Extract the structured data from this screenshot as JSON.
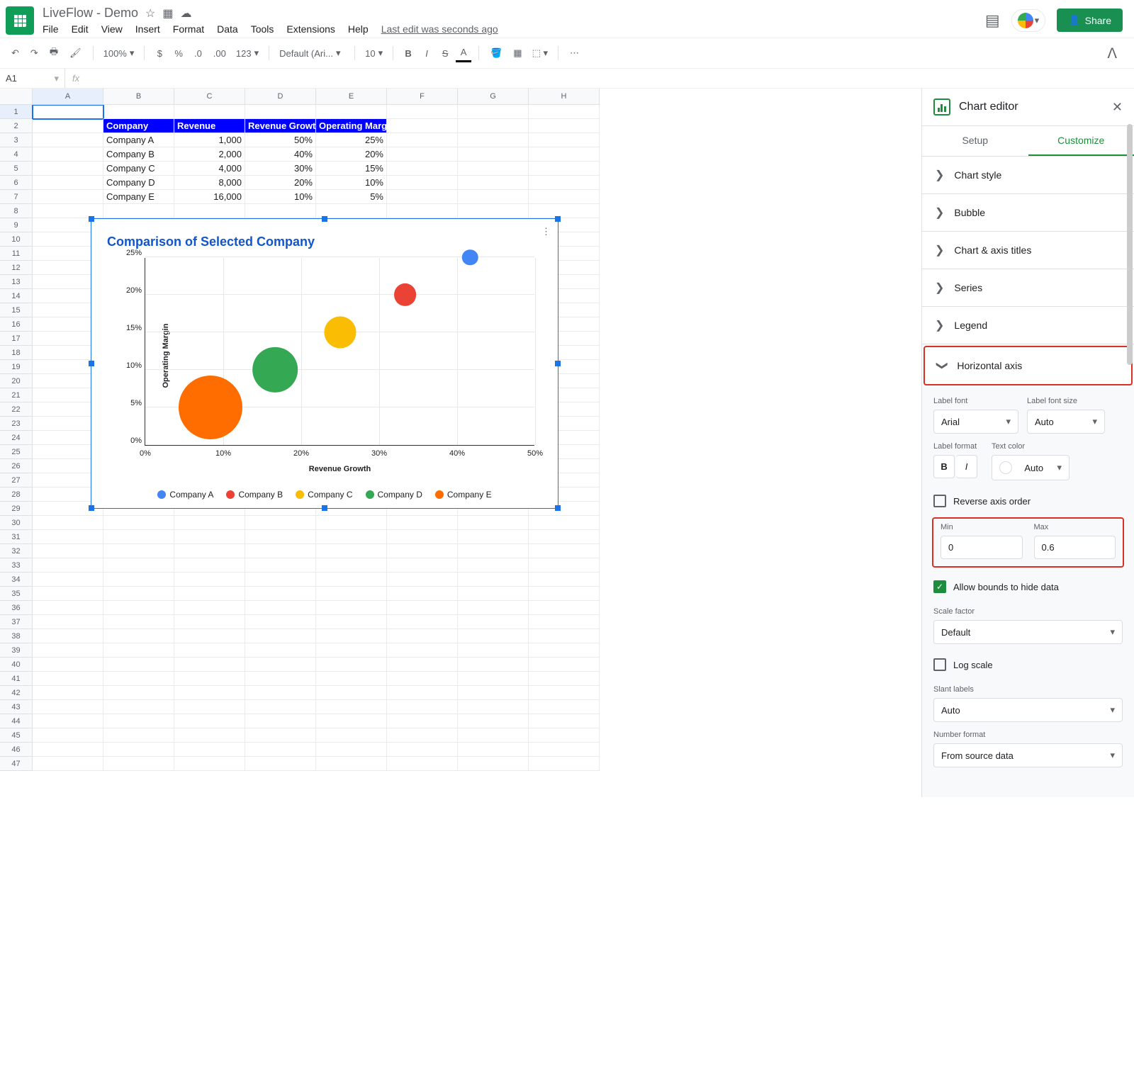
{
  "doc": {
    "title": "LiveFlow - Demo"
  },
  "menu": {
    "file": "File",
    "edit": "Edit",
    "view": "View",
    "insert": "Insert",
    "format": "Format",
    "data": "Data",
    "tools": "Tools",
    "extensions": "Extensions",
    "help": "Help",
    "last_edit": "Last edit was seconds ago"
  },
  "share": {
    "label": "Share"
  },
  "toolbar": {
    "zoom": "100%",
    "font": "Default (Ari...",
    "size": "10",
    "number_fmt": "123"
  },
  "name_box": "A1",
  "columns": [
    "A",
    "B",
    "C",
    "D",
    "E",
    "F",
    "G",
    "H"
  ],
  "table": {
    "headers": [
      "Company",
      "Revenue",
      "Revenue Growth",
      "Operating Margin"
    ],
    "rows": [
      [
        "Company A",
        "1,000",
        "50%",
        "25%"
      ],
      [
        "Company B",
        "2,000",
        "40%",
        "20%"
      ],
      [
        "Company C",
        "4,000",
        "30%",
        "15%"
      ],
      [
        "Company D",
        "8,000",
        "20%",
        "10%"
      ],
      [
        "Company E",
        "16,000",
        "10%",
        "5%"
      ]
    ]
  },
  "chart_data": {
    "type": "bubble",
    "title": "Comparison of Selected Company",
    "xlabel": "Revenue Growth",
    "ylabel": "Operating Margin",
    "xticks": [
      "0%",
      "10%",
      "20%",
      "30%",
      "40%",
      "50%"
    ],
    "yticks": [
      "0%",
      "5%",
      "10%",
      "15%",
      "20%",
      "25%"
    ],
    "xlim": [
      0,
      0.6
    ],
    "ylim": [
      0,
      0.25
    ],
    "series": [
      {
        "name": "Company A",
        "x": 0.5,
        "y": 0.25,
        "size": 1000,
        "color": "#4285f4"
      },
      {
        "name": "Company B",
        "x": 0.4,
        "y": 0.2,
        "size": 2000,
        "color": "#ea4335"
      },
      {
        "name": "Company C",
        "x": 0.3,
        "y": 0.15,
        "size": 4000,
        "color": "#fbbc04"
      },
      {
        "name": "Company D",
        "x": 0.2,
        "y": 0.1,
        "size": 8000,
        "color": "#34a853"
      },
      {
        "name": "Company E",
        "x": 0.1,
        "y": 0.05,
        "size": 16000,
        "color": "#ff6d01"
      }
    ]
  },
  "editor": {
    "title": "Chart editor",
    "tabs": {
      "setup": "Setup",
      "customize": "Customize"
    },
    "sections": {
      "chart_style": "Chart style",
      "bubble": "Bubble",
      "chart_axis_titles": "Chart & axis titles",
      "series": "Series",
      "legend": "Legend",
      "horizontal_axis": "Horizontal axis"
    },
    "haxis": {
      "label_font_lbl": "Label font",
      "label_font": "Arial",
      "label_size_lbl": "Label font size",
      "label_size": "Auto",
      "label_format_lbl": "Label format",
      "text_color_lbl": "Text color",
      "text_color": "Auto",
      "reverse": "Reverse axis order",
      "min_lbl": "Min",
      "min": "0",
      "max_lbl": "Max",
      "max": "0.6",
      "allow_bounds": "Allow bounds to hide data",
      "scale_factor_lbl": "Scale factor",
      "scale_factor": "Default",
      "log_scale": "Log scale",
      "slant_lbl": "Slant labels",
      "slant": "Auto",
      "number_format_lbl": "Number format",
      "number_format": "From source data"
    }
  }
}
